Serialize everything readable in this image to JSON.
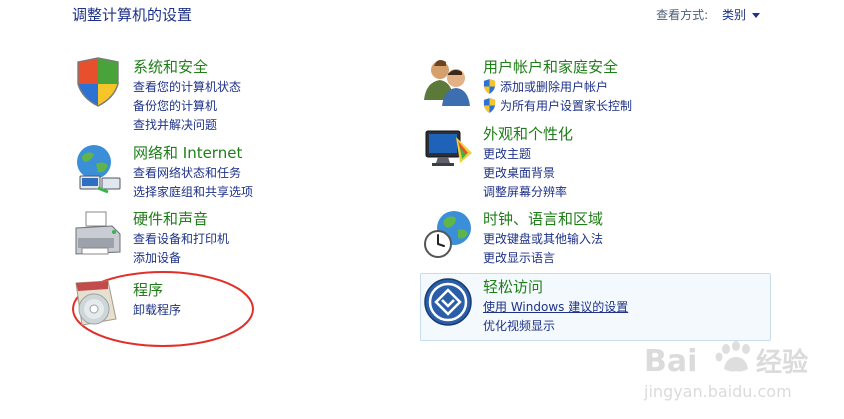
{
  "header": {
    "title": "调整计算机的设置",
    "view_by_label": "查看方式:",
    "view_by_value": "类别"
  },
  "categories": [
    {
      "title": "系统和安全",
      "icon": "shield-flag-icon",
      "links": [
        "查看您的计算机状态",
        "备份您的计算机",
        "查找并解决问题"
      ]
    },
    {
      "title": "网络和 Internet",
      "icon": "network-globe-icon",
      "links": [
        "查看网络状态和任务",
        "选择家庭组和共享选项"
      ]
    },
    {
      "title": "硬件和声音",
      "icon": "printer-icon",
      "links": [
        "查看设备和打印机",
        "添加设备"
      ]
    },
    {
      "title": "程序",
      "icon": "programs-disc-icon",
      "links": [
        "卸载程序"
      ]
    },
    {
      "title": "用户帐户和家庭安全",
      "icon": "users-icon",
      "links": [
        "添加或删除用户帐户",
        "为所有用户设置家长控制"
      ]
    },
    {
      "title": "外观和个性化",
      "icon": "monitor-palette-icon",
      "links": [
        "更改主题",
        "更改桌面背景",
        "调整屏幕分辨率"
      ]
    },
    {
      "title": "时钟、语言和区域",
      "icon": "clock-globe-icon",
      "links": [
        "更改键盘或其他输入法",
        "更改显示语言"
      ]
    },
    {
      "title": "轻松访问",
      "icon": "ease-of-access-icon",
      "links": [
        "使用 Windows 建议的设置",
        "优化视频显示"
      ]
    }
  ],
  "watermark": {
    "brand": "Bai",
    "brand2": "经验",
    "url": "jingyan.baidu.com"
  },
  "colors": {
    "category_title": "#1f7e18",
    "link": "#1e3287",
    "annotation": "#e0302a"
  }
}
